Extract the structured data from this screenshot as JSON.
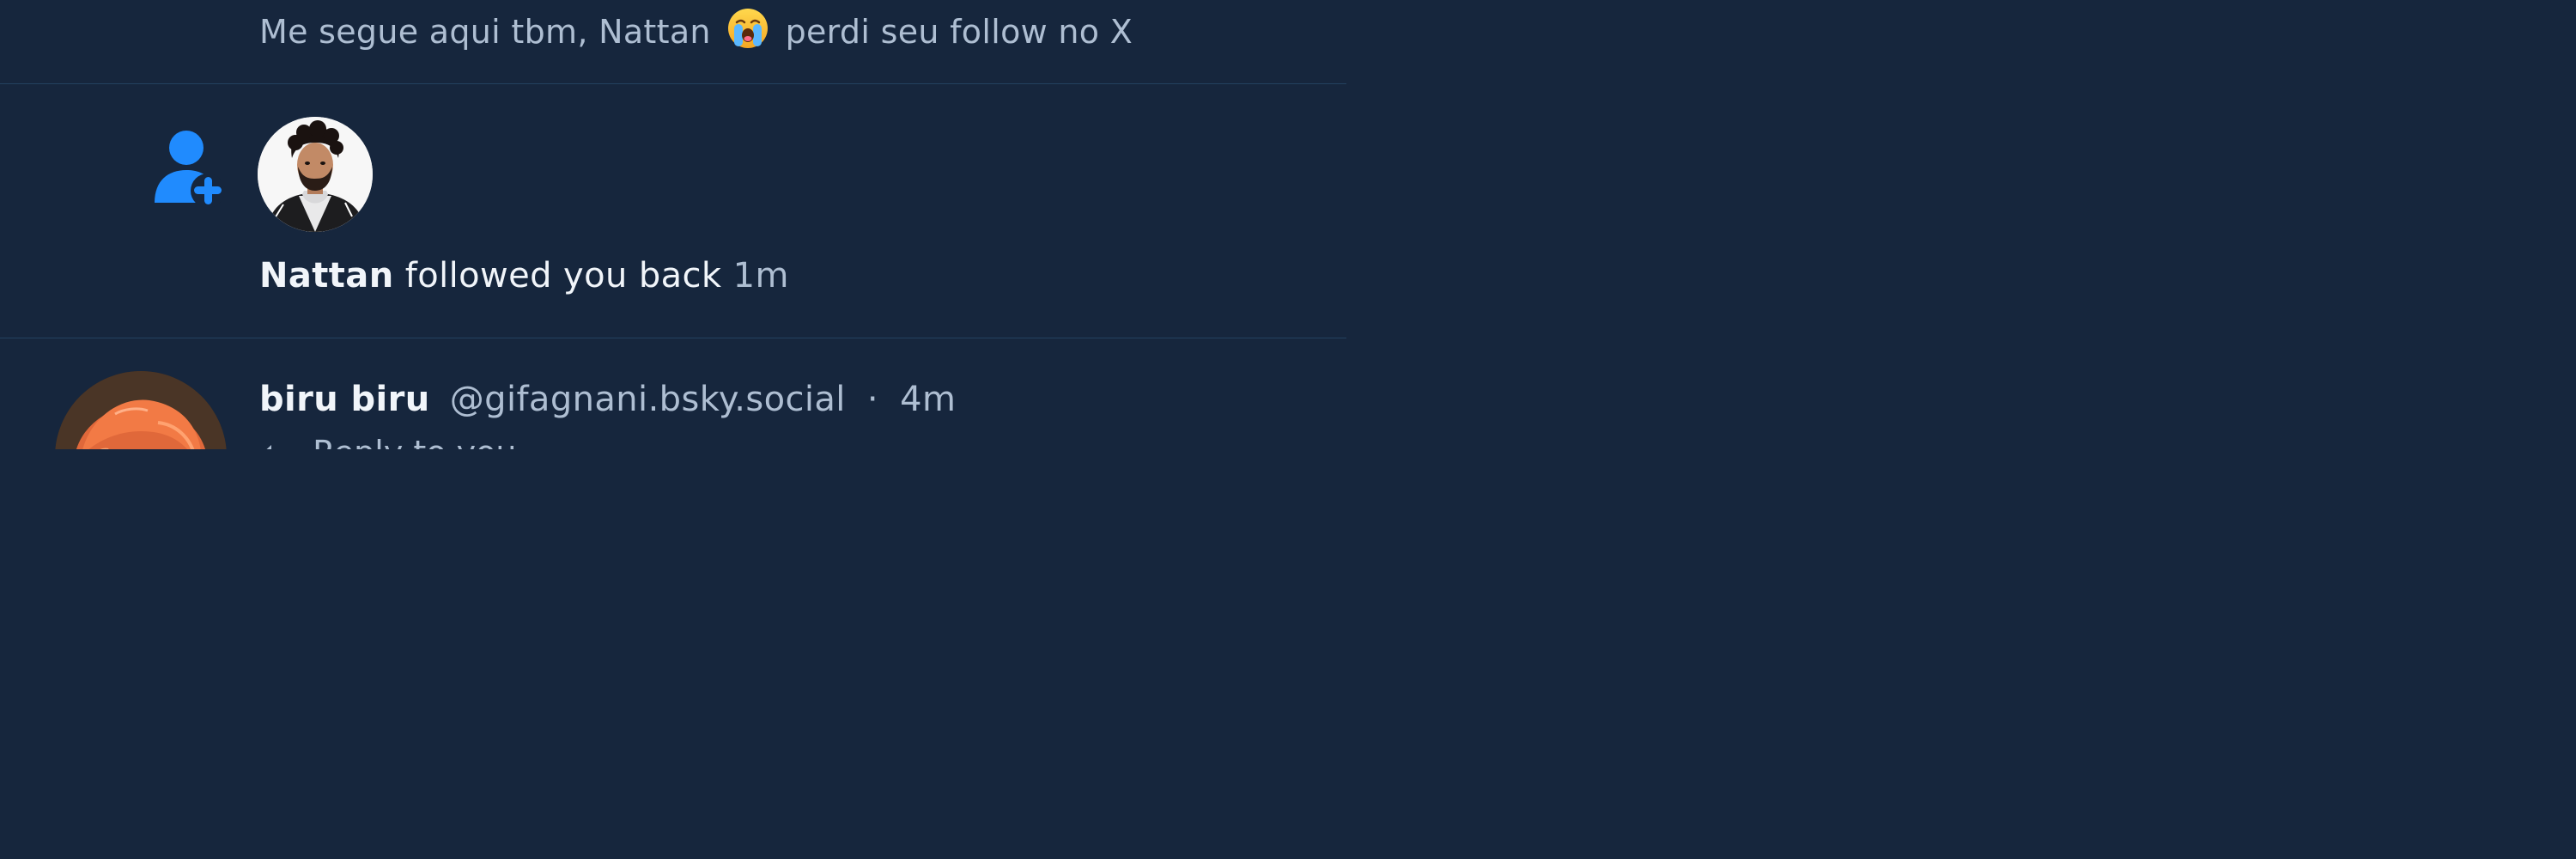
{
  "previous_post": {
    "text_before_emoji": "Me segue aqui tbm, Nattan",
    "emoji": "crying-face-emoji",
    "text_after_emoji": "perdi seu follow no X"
  },
  "follow_notification": {
    "icon": "person-add-icon",
    "name": "Nattan",
    "action_text": "followed you back",
    "time": "1m"
  },
  "next_post": {
    "display_name": "biru biru",
    "handle": "@gifagnani.bsky.social",
    "separator": "·",
    "time": "4m",
    "reply_text": "Reply to you"
  },
  "colors": {
    "background": "#16263d",
    "divider": "#23415f",
    "accent": "#208bfe",
    "text_primary": "#f1f5fa",
    "text_secondary": "#aebed2"
  }
}
